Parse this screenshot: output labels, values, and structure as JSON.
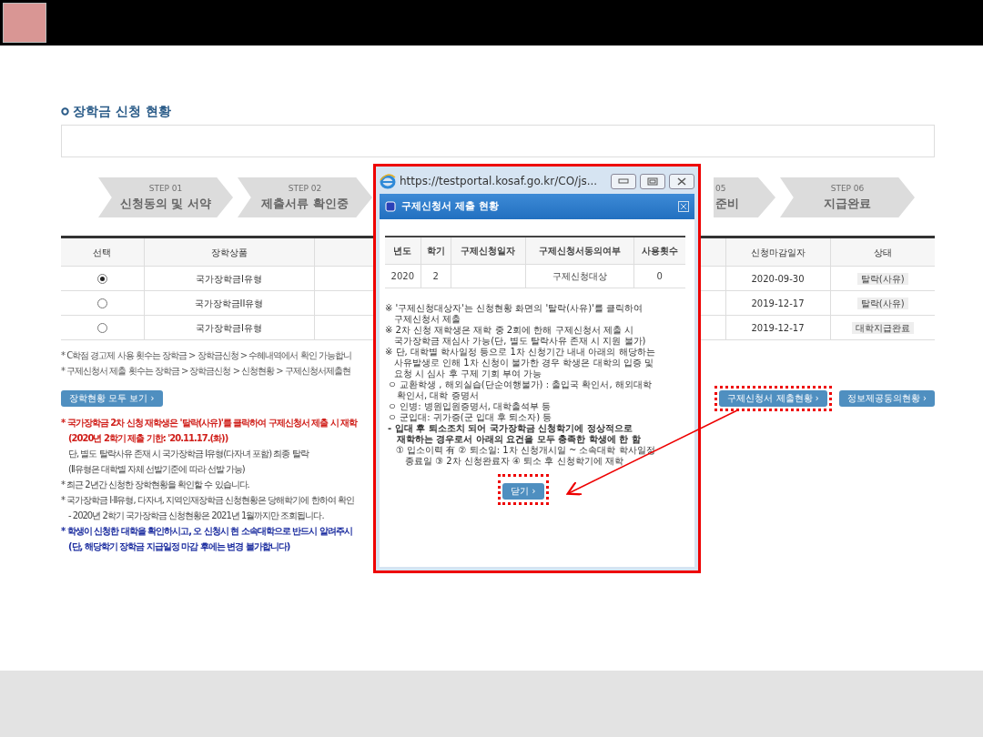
{
  "section_title": "장학금 신청 현황",
  "steps": [
    {
      "step": "STEP 01",
      "title": "신청동의 및 서약",
      "partial": false
    },
    {
      "step": "STEP 02",
      "title": "제출서류 확인중",
      "partial": false
    },
    {
      "step": "05",
      "title": "준비",
      "partial": true
    },
    {
      "step": "STEP 06",
      "title": "지급완료",
      "partial": false
    }
  ],
  "table": {
    "columns": [
      "선택",
      "장학상품",
      "신청마감일자",
      "상태"
    ],
    "rows": [
      {
        "selected": true,
        "product": "국가장학금I유형",
        "deadline": "2020-09-30",
        "status": "탈락(사유)"
      },
      {
        "selected": false,
        "product": "국가장학금II유형",
        "deadline": "2019-12-17",
        "status": "탈락(사유)"
      },
      {
        "selected": false,
        "product": "국가장학금I유형",
        "deadline": "2019-12-17",
        "status": "대학지급완료"
      }
    ]
  },
  "info_notes": [
    "* C학점 경고제 사용 횟수는 장학금 > 장학금신청 > 수혜내역에서 확인 가능합니",
    "* 구제신청서 제출 횟수는 장학금 > 장학금신청 > 신청현황 > 구제신청서제출현"
  ],
  "buttons": [
    {
      "label": "장학현황 모두 보기 ›",
      "highlighted": false
    },
    {
      "label": "구제신청서 제출현황 ›",
      "highlighted": true
    },
    {
      "label": "정보제공동의현황 ›",
      "highlighted": false
    }
  ],
  "notes": [
    {
      "kind": "red",
      "text": "* 국가장학금 2차 신청 재학생은 '탈락(사유)'를 클릭하여 구제신청서 제출 시 재학"
    },
    {
      "kind": "red-indent",
      "text": "(2020년 2학기 제출 기한: '20.11.17.(화))"
    },
    {
      "kind": "indent",
      "text": "단, 별도 탈락사유 존재 시 국가장학금 I유형(다자녀 포함) 최종 탈락"
    },
    {
      "kind": "indent",
      "text": "(II유형은 대학별 자체 선발기준에 따라 선발 가능)"
    },
    {
      "kind": "plain",
      "text": "* 최근 2년간 신청한 장학현황을 확인할 수 있습니다."
    },
    {
      "kind": "plain",
      "text": "* 국가장학금 I·II유형, 다자녀, 지역인재장학금 신청현황은 당해학기에 한하여 확인"
    },
    {
      "kind": "indent",
      "text": "- 2020년 2학기 국가장학금 신청현황은 2021년 1월까지만 조회됩니다."
    },
    {
      "kind": "blue",
      "text": "* 학생이 신청한 대학을 확인하시고, 오 신청시 현 소속대학으로 반드시 알려주시"
    },
    {
      "kind": "blue-indent",
      "text": "(단, 해당학기 장학금 지급일정 마감 후에는 변경 불가합니다)"
    }
  ],
  "popup": {
    "url": "https://testportal.kosaf.go.kr/CO/js...",
    "title": "구제신청서 제출 현황",
    "table": {
      "columns": [
        "년도",
        "학기",
        "구제신청일자",
        "구제신청서동의여부",
        "사용횟수"
      ],
      "rows": [
        [
          "2020",
          "2",
          "",
          "구제신청대상",
          "0"
        ]
      ]
    },
    "notes": [
      {
        "kind": "mark",
        "lines": [
          "※ '구제신청대상자'는 신청현황 화면의 '탈락(사유)'를 클릭하여",
          "구제신청서 제출"
        ]
      },
      {
        "kind": "mark",
        "lines": [
          "※ 2차 신청 재학생은 재학 중 2회에 한해 구제신청서 제출 시",
          "국가장학금 재심사 가능(단, 별도 탈락사유 존재 시 지원 불가)"
        ]
      },
      {
        "kind": "mark",
        "lines": [
          "※ 단, 대학별 학사일정 등으로 1차 신청기간 내내 아래의 해당하는",
          "사유발생로 인해 1차 신청이 불가한 경우 학생은 대학의 입증 및",
          "요청 시 심사 후 구제 기회 부여 가능"
        ]
      },
      {
        "kind": "circle",
        "lines": [
          "ㅇ 교환학생 , 해외실습(단순여행불가) : 출입국 확인서, 해외대학",
          "확인서, 대학 증명서"
        ]
      },
      {
        "kind": "circle",
        "lines": [
          "ㅇ 인병: 병원입원증명서, 대학출석부 등"
        ]
      },
      {
        "kind": "circle",
        "lines": [
          "ㅇ 군입대: 귀가증(군 입대 후 퇴소자) 등"
        ]
      },
      {
        "kind": "dash",
        "lines": [
          "- 입대 후 퇴소조치 되어 국가장학금 신청학기에 정상적으로",
          "재학하는 경우로서 아래의 요건을 모두 충족한 학생에 한 함"
        ]
      },
      {
        "kind": "num",
        "lines": [
          "① 입소이력 有 ② 퇴소일: 1차 신청개시일 ~ 소속대학 학사일정",
          "종료일 ③ 2차 신청완료자 ④ 퇴소 후 신청학기에 재학"
        ]
      }
    ],
    "close_button": {
      "label": "닫기 ›",
      "highlighted": true
    }
  }
}
